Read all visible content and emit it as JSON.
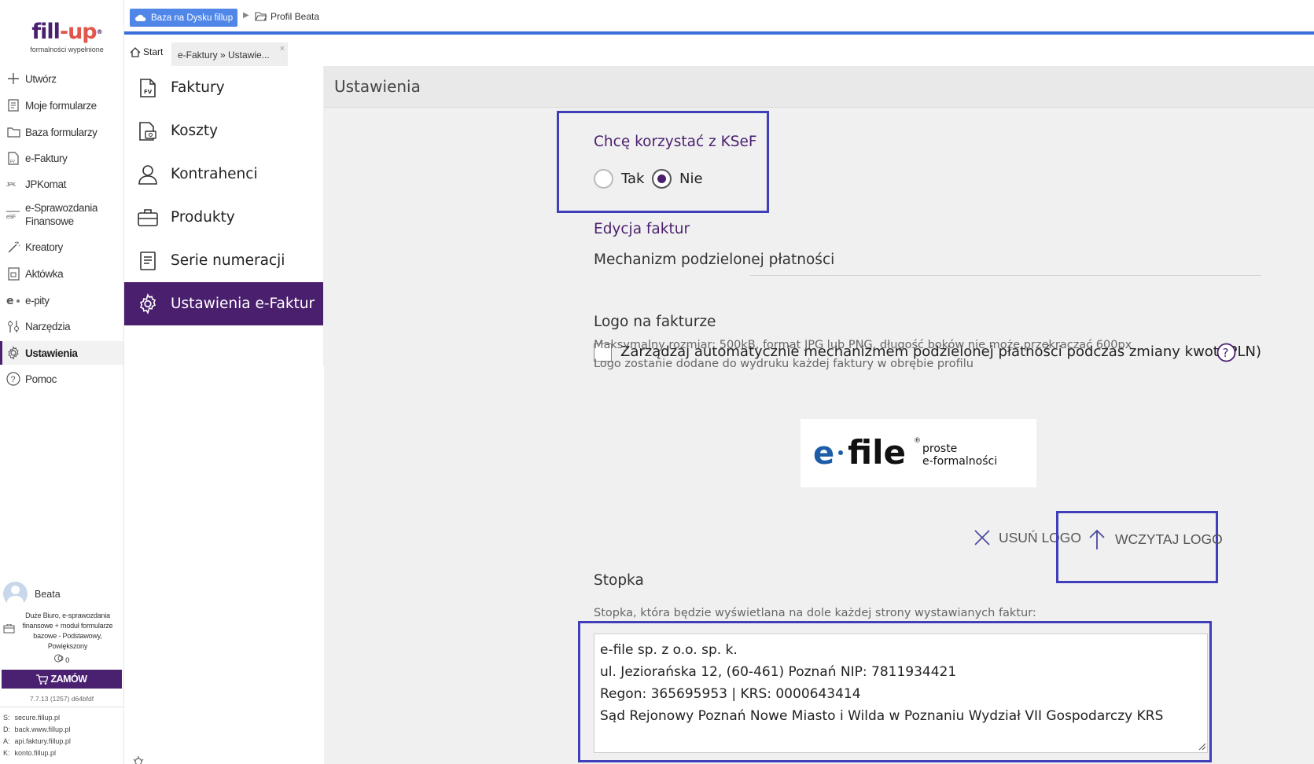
{
  "brand": {
    "name_left": "fill",
    "name_right": "up",
    "reg": "®",
    "tagline": "formalności wypełnione",
    "color": "#4a2070",
    "accent": "#e2574c"
  },
  "nav": [
    {
      "label": "Utwórz",
      "icon": "plus-icon"
    },
    {
      "label": "Moje formularze",
      "icon": "document-icon"
    },
    {
      "label": "Baza formularzy",
      "icon": "folder-icon"
    },
    {
      "label": "e-Faktury",
      "icon": "invoice-icon"
    },
    {
      "label": "JPKomat",
      "icon": "jpk-icon"
    },
    {
      "label": "e-Sprawozdania",
      "label2": "Finansowe",
      "icon": "esf-icon"
    },
    {
      "label": "Kreatory",
      "icon": "wand-icon"
    },
    {
      "label": "Aktówka",
      "icon": "briefcase-icon"
    },
    {
      "label": "e-pity",
      "icon": "epity-icon"
    },
    {
      "label": "Narzędzia",
      "icon": "tools-icon"
    },
    {
      "label": "Ustawienia",
      "icon": "gear-icon"
    },
    {
      "label": "Pomoc",
      "icon": "help-icon"
    }
  ],
  "user": {
    "name": "Beata",
    "plan": "Duże Biuro, e-sprawozdania finansowe + moduł formularze bazowe - Podstawowy, Powiększony",
    "coins": "0",
    "order_label": "ZAMÓW",
    "version": "7.7.13 (1257) d64bfdf",
    "servers": [
      {
        "key": "S:",
        "value": "secure.fillup.pl"
      },
      {
        "key": "D:",
        "value": "back.www.fillup.pl"
      },
      {
        "key": "A:",
        "value": "api.faktury.fillup.pl"
      },
      {
        "key": "K:",
        "value": "konto.fillup.pl"
      }
    ]
  },
  "topbar": {
    "cloud_label": "Baza na Dysku fillup",
    "profile_label": "Profil Beata",
    "accent": "#3b6ed6"
  },
  "tabs": {
    "start": "Start",
    "current": "e-Faktury » Ustawie...",
    "close": "×"
  },
  "submenu": [
    {
      "label": "Faktury",
      "icon": "invoice-fv-icon"
    },
    {
      "label": "Koszty",
      "icon": "costs-icon"
    },
    {
      "label": "Kontrahenci",
      "icon": "person-icon"
    },
    {
      "label": "Produkty",
      "icon": "briefcase-icon"
    },
    {
      "label": "Serie numeracji",
      "icon": "list-icon"
    },
    {
      "label": "Ustawienia e-Faktur",
      "icon": "gear-icon"
    }
  ],
  "content": {
    "title": "Ustawienia",
    "ksef": {
      "heading": "Chcę korzystać z KSeF",
      "option_yes": "Tak",
      "option_no": "Nie",
      "selected": "Nie"
    },
    "edit": {
      "heading": "Edycja faktur"
    },
    "split": {
      "heading": "Mechanizm podzielonej płatności",
      "checkbox_label": "Zarządzaj automatycznie mechanizmem podzielonej płatności podczas zmiany kwot (PLN)",
      "checked": false
    },
    "logo": {
      "heading": "Logo na fakturze",
      "hint1": "Maksymalny rozmiar: 500kB, format JPG lub PNG, długość boków nie może przekraczać 600px",
      "hint2": "Logo zostanie dodane do wydruku każdej faktury w obrębie profilu",
      "preview": {
        "e": "e",
        "file": "file",
        "reg": "®",
        "tag1": "proste",
        "tag2": "e-formalności"
      },
      "remove_label": "USUŃ LOGO",
      "upload_label": "WCZYTAJ LOGO"
    },
    "footer": {
      "heading": "Stopka",
      "hint": "Stopka, która będzie wyświetlana na dole każdej strony wystawianych faktur:",
      "text": "e-file sp. z o.o. sp. k.\nul. Jeziorańska 12, (60-461) Poznań NIP: 7811934421\nRegon: 365695953 | KRS: 0000643414\nSąd Rejonowy Poznań Nowe Miasto i Wilda w Poznaniu Wydział VII Gospodarczy KRS"
    },
    "highlight_color": "#3f3fba"
  }
}
